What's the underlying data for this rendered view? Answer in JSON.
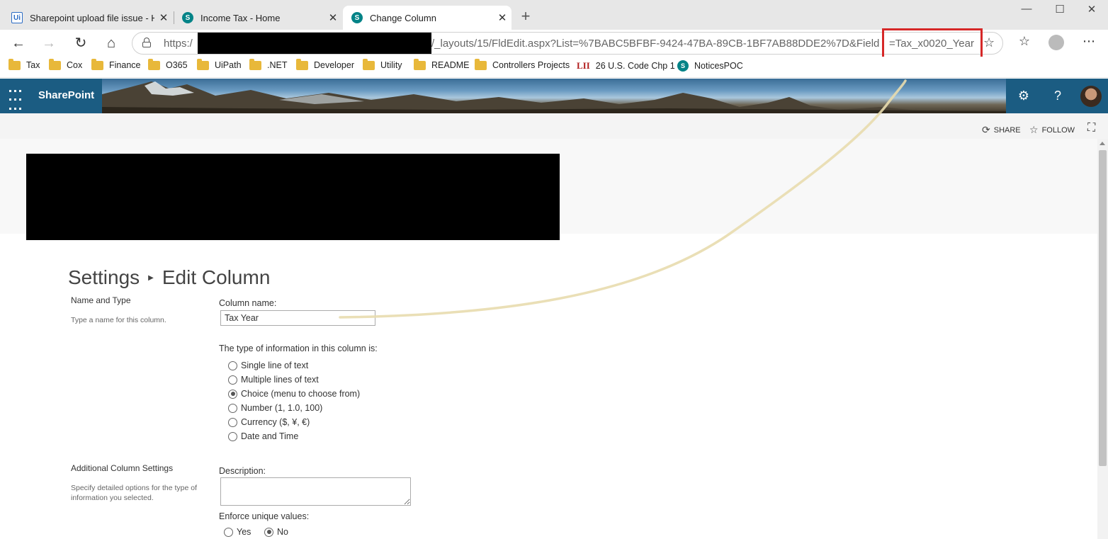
{
  "tabs": [
    {
      "label": "Sharepoint upload file issue - He",
      "icon": "uipath-icon"
    },
    {
      "label": "Income Tax - Home",
      "icon": "sharepoint-icon"
    },
    {
      "label": "Change Column",
      "icon": "sharepoint-icon",
      "active": true
    }
  ],
  "address_bar": {
    "scheme": "https:/",
    "path": "/_layouts/15/FldEdit.aspx?List=%7BABC5BFBF-9424-47BA-89CB-1BF7AB88DDE2%7D&Field",
    "field_param": "=Tax_x0020_Year"
  },
  "bookmarks": [
    "Tax",
    "Cox",
    "Finance",
    "O365",
    "UiPath",
    ".NET",
    "Developer",
    "Utility",
    "README",
    "Controllers Projects",
    "26 U.S. Code Chp 1",
    "NoticesPOC"
  ],
  "bookmark_lii_prefix": "LII",
  "suite": {
    "brand": "SharePoint"
  },
  "actions": {
    "share": "SHARE",
    "follow": "FOLLOW"
  },
  "breadcrumb": {
    "root": "Settings",
    "current": "Edit Column"
  },
  "name_section": {
    "title": "Name and Type",
    "description": "Type a name for this column.",
    "column_name_label": "Column name:",
    "column_name_value": "Tax Year",
    "type_label": "The type of information in this column is:",
    "types": [
      {
        "label": "Single line of text",
        "checked": false
      },
      {
        "label": "Multiple lines of text",
        "checked": false
      },
      {
        "label": "Choice (menu to choose from)",
        "checked": true
      },
      {
        "label": "Number (1, 1.0, 100)",
        "checked": false
      },
      {
        "label": "Currency ($, ¥, €)",
        "checked": false
      },
      {
        "label": "Date and Time",
        "checked": false
      }
    ]
  },
  "additional_section": {
    "title": "Additional Column Settings",
    "description_line1": "Specify detailed options for the type of",
    "description_line2": "information you selected.",
    "description_label": "Description:",
    "description_value": "",
    "unique_label": "Enforce unique values:",
    "unique_options": [
      {
        "label": "Yes",
        "checked": false
      },
      {
        "label": "No",
        "checked": true
      }
    ]
  },
  "colors": {
    "suite_bar": "#1b5c82",
    "highlight": "#d62828",
    "annotation_stroke": "#e8dcae"
  }
}
